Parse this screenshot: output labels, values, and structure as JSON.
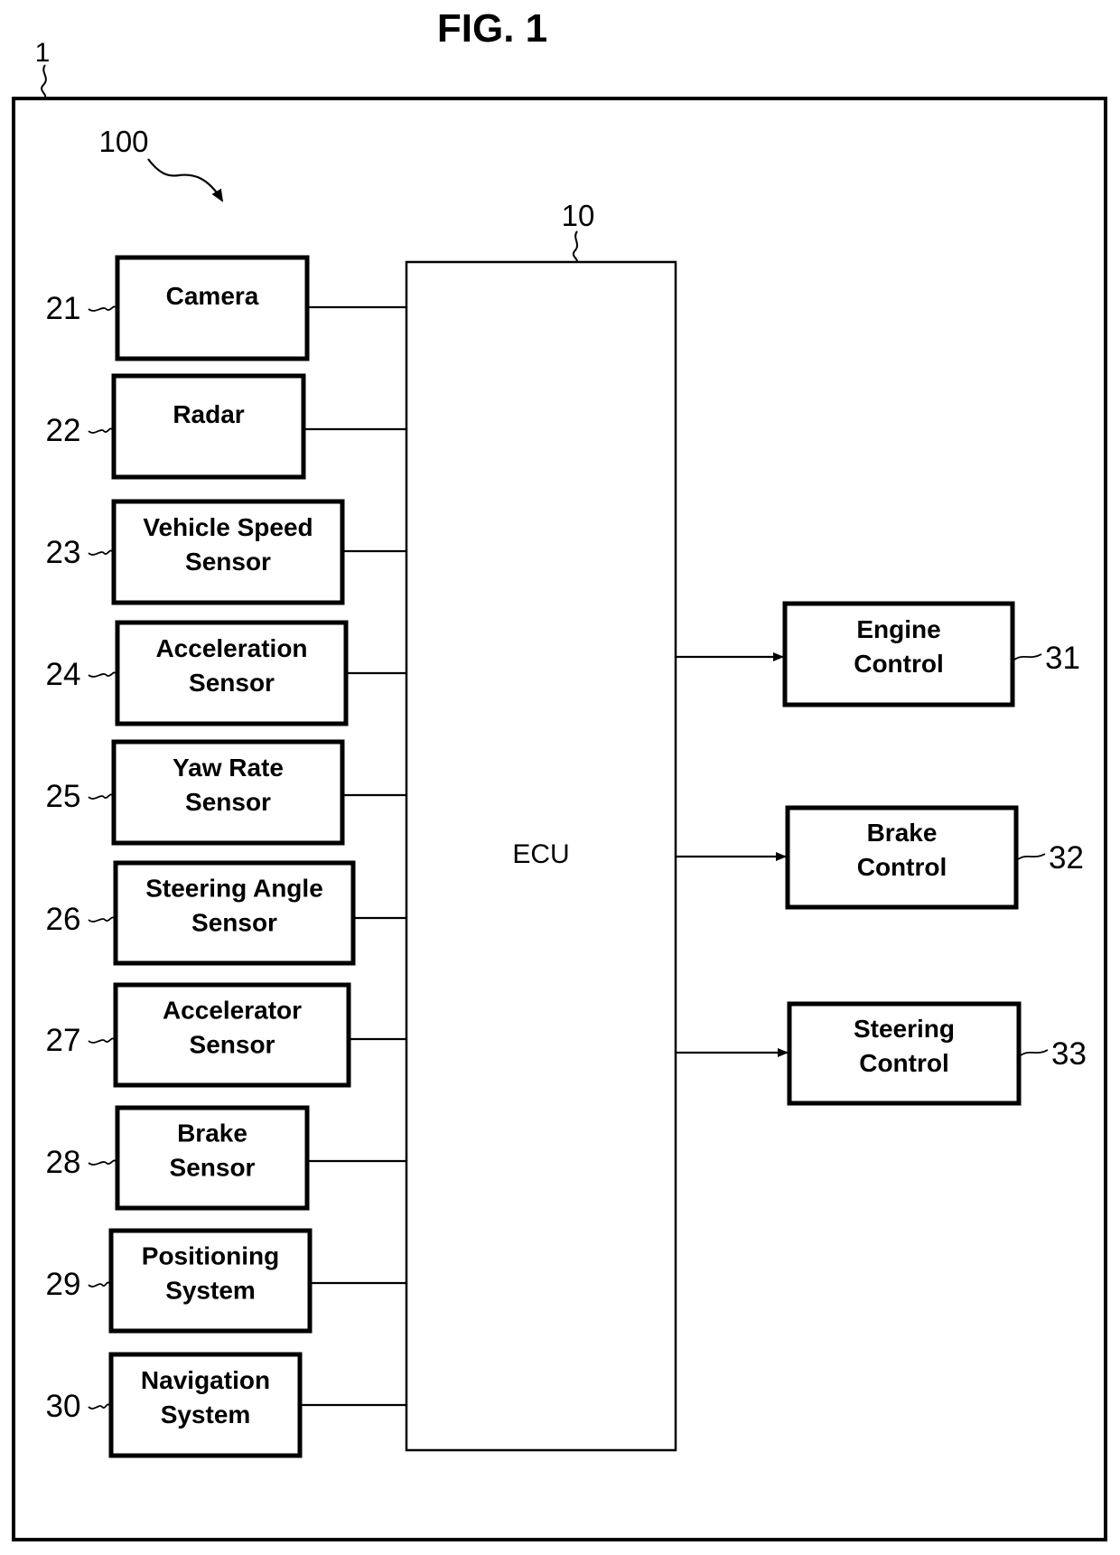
{
  "figure": {
    "title": "FIG. 1",
    "vehicle_ref": "1",
    "system_ref": "100"
  },
  "ecu": {
    "ref": "10",
    "label": "ECU"
  },
  "inputs": [
    {
      "ref": "21",
      "lines": [
        "Camera"
      ]
    },
    {
      "ref": "22",
      "lines": [
        "Radar"
      ]
    },
    {
      "ref": "23",
      "lines": [
        "Vehicle Speed",
        "Sensor"
      ]
    },
    {
      "ref": "24",
      "lines": [
        "Acceleration",
        "Sensor"
      ]
    },
    {
      "ref": "25",
      "lines": [
        "Yaw Rate",
        "Sensor"
      ]
    },
    {
      "ref": "26",
      "lines": [
        "Steering Angle",
        "Sensor"
      ]
    },
    {
      "ref": "27",
      "lines": [
        "Accelerator",
        "Sensor"
      ]
    },
    {
      "ref": "28",
      "lines": [
        "Brake",
        "Sensor"
      ]
    },
    {
      "ref": "29",
      "lines": [
        "Positioning",
        "System"
      ]
    },
    {
      "ref": "30",
      "lines": [
        "Navigation",
        "System"
      ]
    }
  ],
  "outputs": [
    {
      "ref": "31",
      "lines": [
        "Engine",
        "Control"
      ]
    },
    {
      "ref": "32",
      "lines": [
        "Brake",
        "Control"
      ]
    },
    {
      "ref": "33",
      "lines": [
        "Steering",
        "Control"
      ]
    }
  ],
  "colors": {
    "stroke": "#000000",
    "background": "#ffffff"
  }
}
